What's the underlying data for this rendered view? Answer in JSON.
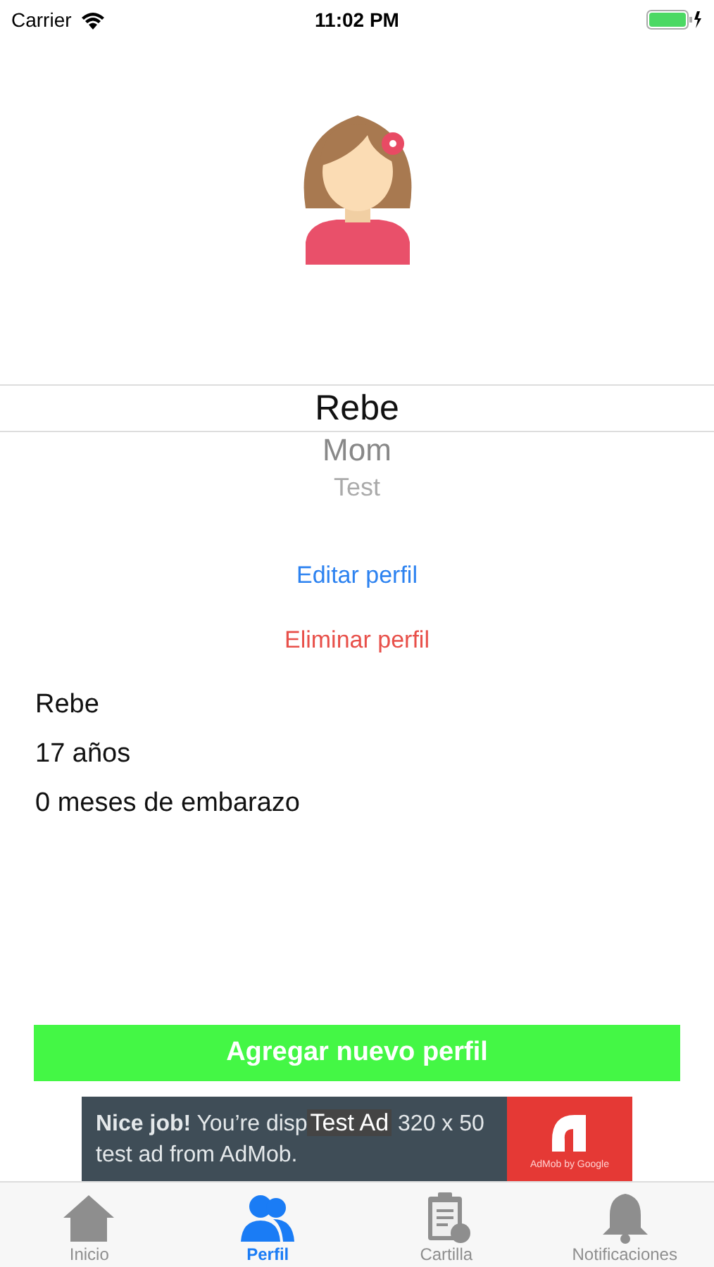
{
  "status_bar": {
    "carrier": "Carrier",
    "time": "11:02 PM"
  },
  "profile_picker": [
    {
      "label": "Rebe",
      "selected": true
    },
    {
      "label": "Mom",
      "selected": false
    },
    {
      "label": "Test",
      "selected": false
    }
  ],
  "edit_link": "Editar perfil",
  "delete_link": "Eliminar perfil",
  "profile_info": [
    "Rebe",
    "17 años",
    "0 meses de embarazo"
  ],
  "add_button": "Agregar nuevo perfil",
  "ad": {
    "text_start": "**Nice job!** You’re disp",
    "badge": "Test Ad",
    "text_end": "320 x 50",
    "text_line2": "test ad from AdMob.",
    "brand": "AdMob by Google"
  },
  "tab_bar": [
    {
      "label": "Inicio",
      "kind": "home",
      "selected": false
    },
    {
      "label": "Perfil",
      "kind": "people",
      "selected": true
    },
    {
      "label": "Cartilla",
      "kind": "clipboard",
      "selected": false
    },
    {
      "label": "Notificaciones",
      "kind": "bell",
      "selected": false
    }
  ]
}
